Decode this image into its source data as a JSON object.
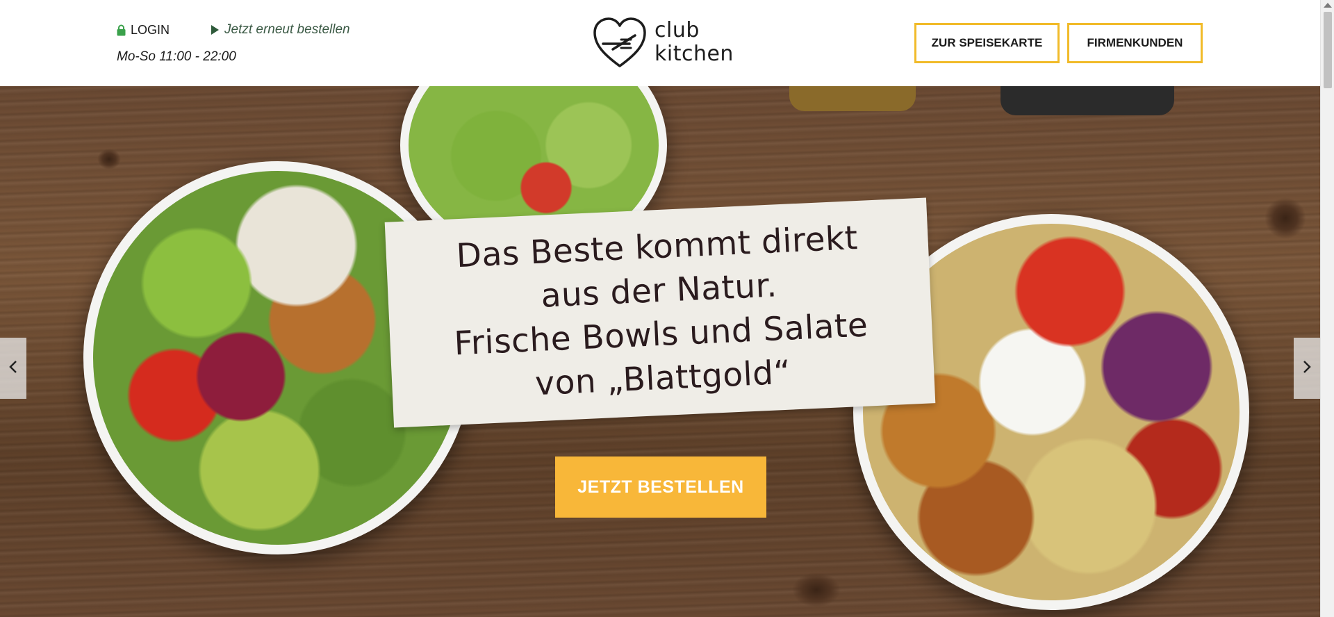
{
  "header": {
    "login_label": "LOGIN",
    "reorder_label": "Jetzt erneut bestellen",
    "opening_hours": "Mo-So 11:00 - 22:00",
    "logo": {
      "line1": "club",
      "line2": "kitchen"
    },
    "menu_button": "ZUR SPEISEKARTE",
    "business_button": "FIRMENKUNDEN"
  },
  "hero": {
    "headline_lines": [
      "Das Beste kommt direkt",
      "aus der Natur.",
      "Frische Bowls und Salate",
      "von „Blattgold“"
    ],
    "cta_label": "JETZT BESTELLEN"
  },
  "icons": {
    "login": "lock-icon",
    "reorder": "play-triangle-icon",
    "logo": "heart-fork-knife-icon",
    "prev": "chevron-left-icon",
    "next": "chevron-right-icon"
  },
  "colors": {
    "accent_yellow": "#f8b739",
    "button_border": "#f1bb2a",
    "lock_green": "#3aa14b",
    "reorder_green": "#3b5a45",
    "card_bg": "#efede7",
    "headline_text": "#2a1b1e"
  }
}
